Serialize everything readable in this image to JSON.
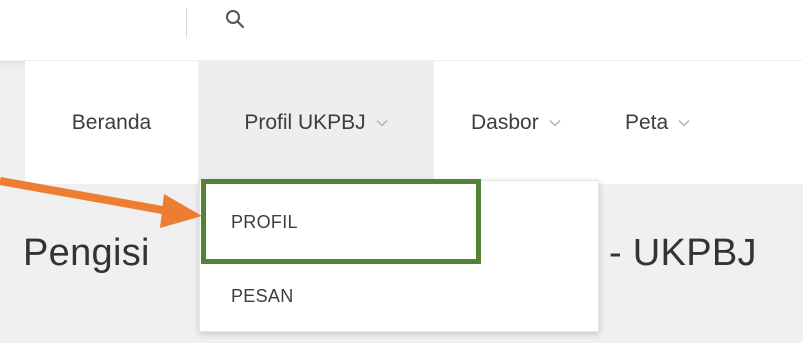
{
  "topbar": {
    "search_icon": "search-icon"
  },
  "nav": {
    "items": [
      {
        "label": "Beranda",
        "has_dropdown": false
      },
      {
        "label": "Profil UKPBJ",
        "has_dropdown": true,
        "active": true
      },
      {
        "label": "Dasbor",
        "has_dropdown": true
      },
      {
        "label": "Peta",
        "has_dropdown": true
      }
    ]
  },
  "dropdown": {
    "items": [
      {
        "label": "PROFIL",
        "highlighted": true
      },
      {
        "label": "PESAN"
      }
    ]
  },
  "page": {
    "heading_left": "Pengisi",
    "heading_right": "- UKPBJ"
  },
  "colors": {
    "annotation_arrow": "#ed7d31",
    "highlight_box": "#538135",
    "nav_active_bg": "#eeeeee"
  }
}
